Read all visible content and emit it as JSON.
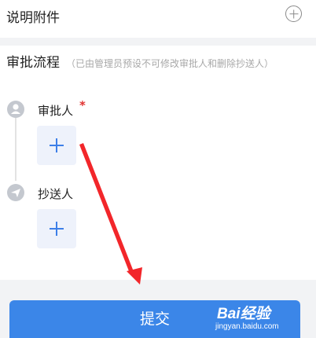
{
  "attachment": {
    "label": "说明附件"
  },
  "approval_flow": {
    "title": "审批流程",
    "hint": "（已由管理员预设不可修改审批人和删除抄送人）",
    "approver": {
      "label": "审批人",
      "required_mark": "*"
    },
    "cc": {
      "label": "抄送人"
    }
  },
  "submit": {
    "label": "提交"
  },
  "watermark": {
    "logo": "Bai经验",
    "url": "jingyan.baidu.com"
  },
  "colors": {
    "accent": "#3b86e8",
    "required": "#e0312f",
    "annotation_arrow": "#f2262a"
  },
  "icons": {
    "attachment_add": "plus-circle-icon",
    "approver_node": "user-icon",
    "cc_node": "paper-plane-icon",
    "add": "plus-icon"
  }
}
